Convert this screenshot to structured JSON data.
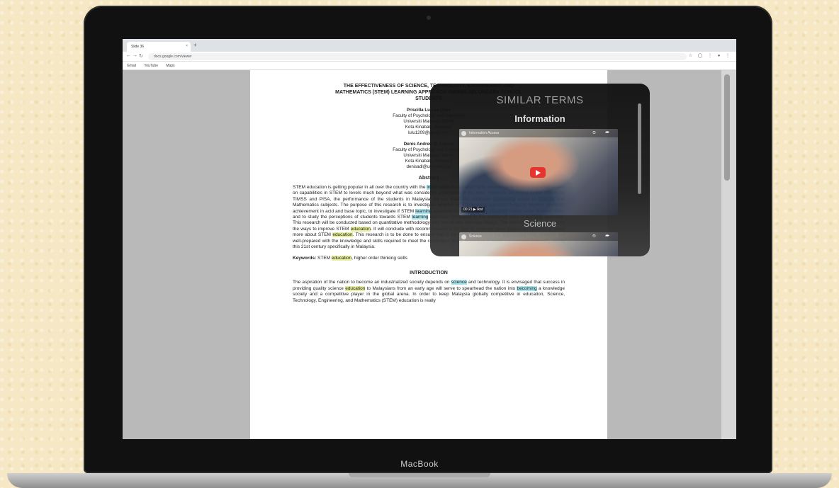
{
  "device": {
    "brand": "MacBook"
  },
  "browser": {
    "tab_title": "Slide 36",
    "tab_close": "×",
    "new_tab": "+",
    "nav": {
      "back": "←",
      "forward": "→",
      "reload": "↻"
    },
    "url": "docs.google.com/viewer",
    "toolbar_icons": "☆ ◯ ⋮ ● ⋮",
    "bookmarks": [
      "Gmail",
      "YouTube",
      "Maps"
    ]
  },
  "paper": {
    "title_lines": [
      "THE EFFECTIVENESS OF SCIENCE, TECHNOLOGY, ENGINEERING AND",
      "MATHEMATICS (STEM) LEARNING APPROACH AMONG SECONDARY SCHOOL",
      "STUDENTS"
    ],
    "author1": {
      "name": "Priscilla Lu Lee Chee",
      "lines": [
        "Faculty of Psychology and Education",
        "Universiti Malaysia Sabah",
        "Kota Kinabalu, Malaysia",
        "lulu1209@gmail.com"
      ]
    },
    "author2": {
      "name": "Denis Andrew D. Lajium",
      "lines": [
        "Faculty of Psychology and Education",
        "Universiti Malaysia Sabah",
        "Kota Kinabalu, Malaysia",
        "denisadl@ums.edu.my"
      ]
    },
    "abstract_heading": "Abstract",
    "abstract": [
      {
        "t": "STEM education is getting popular in all over the country with the "
      },
      {
        "t": "information",
        "h": "blue"
      },
      {
        "t": "-based and highly technological society that emphasizes on "
      },
      {
        "t": "capabilities in STEM to levels much beyond what was considered acceptable in the past. However, according to the reports by TIMSS and PISA, the performance of the students in Malaysia did not meet the minimum "
      },
      {
        "t": "proficiency",
        "h": "blue"
      },
      {
        "t": " levels in "
      },
      {
        "t": "Science",
        "h": "blue"
      },
      {
        "t": " and Mathematics subjects. The purpose of this research is to investigate whether STEM learning approach helps to improve students' achievement in acid and base topic, to investigate if STEM "
      },
      {
        "t": "learning",
        "h": "blue"
      },
      {
        "t": " approach helps to improve "
      },
      {
        "t": "students",
        "h": "blue"
      },
      {
        "t": "' higher order thinking skills, and to study the perceptions of students towards STEM "
      },
      {
        "t": "learning",
        "h": "blue"
      },
      {
        "t": " approach compared to the traditional style of "
      },
      {
        "t": "learning",
        "h": "blue"
      },
      {
        "t": " approach. This research will be conducted based on quantitative methodology with one-to-one interview design. The discussion will be driven by the ways to improve STEM "
      },
      {
        "t": "education",
        "h": "yellow"
      },
      {
        "t": ". It will conclude with recommendations for how to motivate more Malaysian students to know more about STEM "
      },
      {
        "t": "education",
        "h": "yellow"
      },
      {
        "t": ". This research is to be done to ensure that to be really success in the "
      },
      {
        "t": "educational",
        "h": "blue"
      },
      {
        "t": " field, students are well-prepared with the knowledge and skills required to meet the challenges of the world that is being transformed especially during this 21st century specifically in Malaysia."
      }
    ],
    "keywords_label": "Keywords:",
    "keywords": [
      {
        "t": " STEM "
      },
      {
        "t": "education",
        "h": "yellow"
      },
      {
        "t": ", higher order thinking skills"
      }
    ],
    "intro_heading": "INTRODUCTION",
    "intro": [
      {
        "t": "The aspiration of the nation to become an industrialized society depends on "
      },
      {
        "t": "science",
        "h": "blue"
      },
      {
        "t": " and technology. It is envisaged that success in providing quality science "
      },
      {
        "t": "education",
        "h": "yellow"
      },
      {
        "t": " to Malaysians from an early age will serve to spearhead the nation into "
      },
      {
        "t": "becoming",
        "h": "blue"
      },
      {
        "t": " a knowledge society and a competitive player in the global arena. In order to keep Malaysia globally competitive in education, Science, Technology, Engineering, and Mathematics (STEM) education is really"
      }
    ]
  },
  "overlay": {
    "title": "SIMILAR TERMS",
    "term1": "Information",
    "term2": "Science",
    "video1": {
      "duration": "00:21 ▶ Ikat",
      "channel": "Information Access"
    },
    "video2": {
      "channel": "Science"
    }
  },
  "colors": {
    "highlight_blue": "#a9e6ee",
    "highlight_yellow": "#e8ef9e",
    "yt_red": "#e52d27"
  }
}
